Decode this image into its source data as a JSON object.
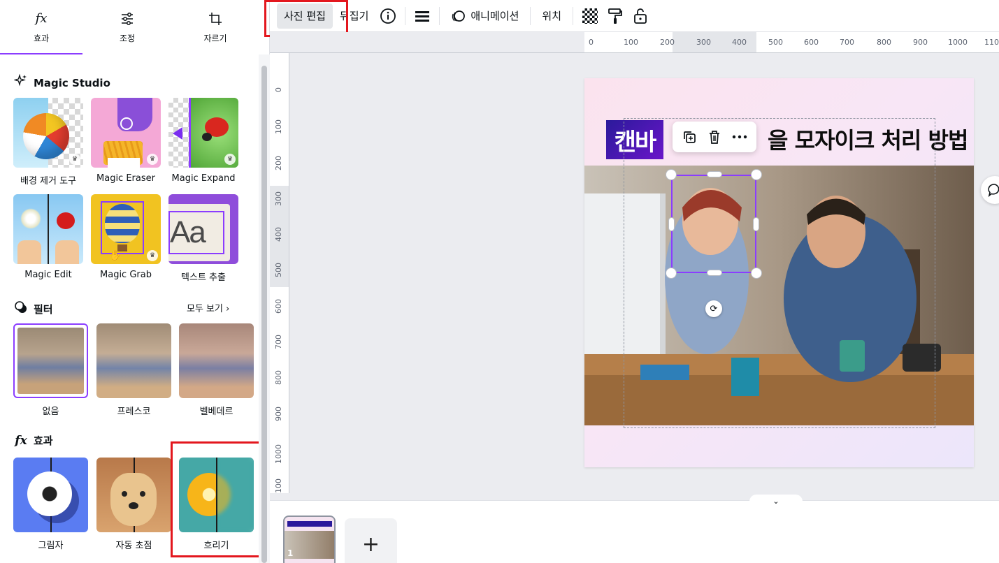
{
  "panel": {
    "tabs": [
      {
        "icon": "fx",
        "label": "효과"
      },
      {
        "icon": "adjust-sliders-icon",
        "label": "조정"
      },
      {
        "icon": "crop-icon",
        "label": "자르기"
      }
    ],
    "magic_studio": {
      "title": "Magic Studio",
      "tools": [
        {
          "label": "배경 제거 도구",
          "premium": true
        },
        {
          "label": "Magic Eraser",
          "premium": true
        },
        {
          "label": "Magic Expand",
          "premium": true
        },
        {
          "label": "Magic Edit",
          "premium": false
        },
        {
          "label": "Magic Grab",
          "premium": true
        },
        {
          "label": "텍스트 추출",
          "premium": false
        }
      ],
      "text_extract_sample": "Aa"
    },
    "filters": {
      "title": "필터",
      "see_all": "모두 보기",
      "items": [
        {
          "label": "없음",
          "selected": true
        },
        {
          "label": "프레스코",
          "selected": false
        },
        {
          "label": "벨베데르",
          "selected": false
        }
      ]
    },
    "effects": {
      "icon": "fx",
      "title": "효과",
      "items": [
        {
          "label": "그림자"
        },
        {
          "label": "자동 초점"
        },
        {
          "label": "흐리기"
        }
      ]
    }
  },
  "toolbar": {
    "edit_photo": "사진 편집",
    "flip": "뒤집기",
    "animate": "애니메이션",
    "position": "위치"
  },
  "ruler": {
    "top": [
      "0",
      "100",
      "200",
      "300",
      "400",
      "500",
      "600",
      "700",
      "800",
      "900",
      "1000",
      "110"
    ],
    "left": [
      "0",
      "100",
      "200",
      "300",
      "400",
      "500",
      "600",
      "700",
      "800",
      "900",
      "1000",
      "100"
    ]
  },
  "canvas": {
    "brand_text": "캔바",
    "heading": "을 모자이크 처리 방법"
  },
  "pages": {
    "current_page": "1",
    "add_page": "+"
  },
  "colors": {
    "accent": "#8b3dff",
    "highlight_red": "#e3171e"
  }
}
